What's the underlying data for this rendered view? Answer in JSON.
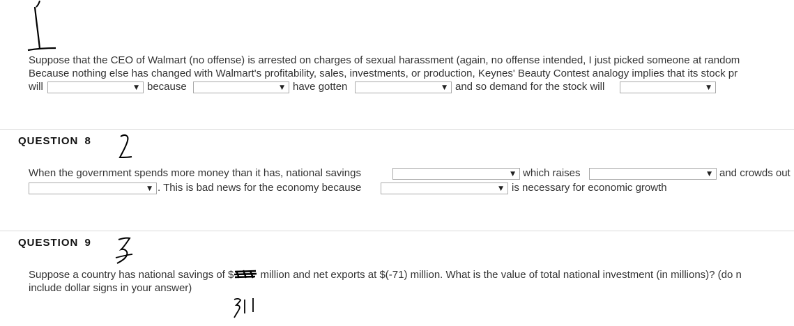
{
  "q1": {
    "handwritten_number": "1",
    "line1": "Suppose that the CEO of Walmart (no offense) is arrested on charges of sexual harassment (again, no offense intended, I just picked someone at random",
    "line2": "Because nothing else has changed with Walmart's profitability, sales, investments, or production, Keynes' Beauty Contest analogy implies that its stock pr",
    "will": "will",
    "because": "because",
    "have_gotten": "have gotten",
    "demand": "and so demand for the stock will"
  },
  "q2": {
    "heading": "QUESTION",
    "heading_num": "8",
    "handwritten_number": "2",
    "text1": "When the government spends more money than it has, national savings",
    "which_raises": "which raises",
    "crowds": "and crowds out",
    "bad_news": ". This is bad news for the economy because",
    "necessary": "is necessary for economic growth"
  },
  "q3": {
    "heading": "QUESTION",
    "heading_num": "9",
    "handwritten_number": "3",
    "line1_pre": "Suppose a country has national savings of $",
    "line1_post": " million and net exports at $(-71) million. What is the value of total national investment (in millions)? (do n",
    "line2": "include dollar signs in your answer)",
    "handwritten_answer": "311"
  }
}
